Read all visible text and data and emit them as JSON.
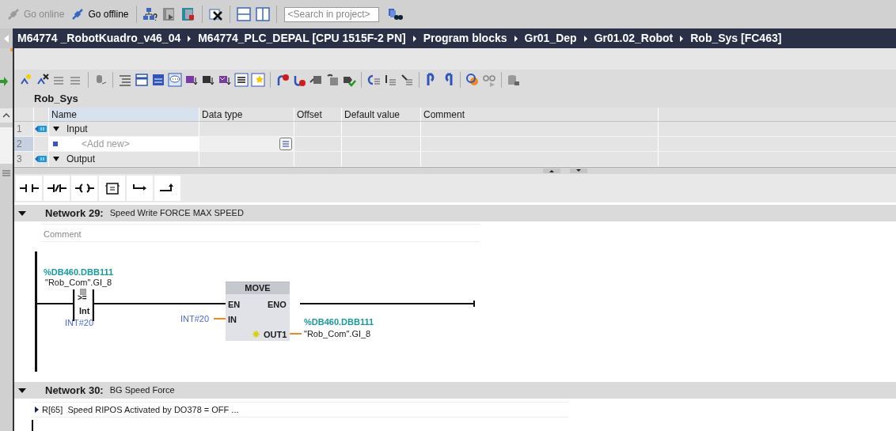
{
  "toolbar": {
    "buttons": [
      {
        "label": "Go online",
        "disabled": true
      },
      {
        "label": "Go offline",
        "disabled": false
      }
    ],
    "search": {
      "placeholder": "<Search in project>"
    }
  },
  "breadcrumb": [
    "M64774 _RobotKuadro_v46_04",
    "M64774_PLC_DEPAL [CPU 1515F-2 PN]",
    "Program blocks",
    "Gr01_Dep",
    "Gr01.02_Robot",
    "Rob_Sys [FC463]"
  ],
  "block_interface": {
    "title": "Rob_Sys",
    "columns": [
      "Name",
      "Data type",
      "Offset",
      "Default value",
      "Comment"
    ],
    "rows": [
      {
        "number": "1",
        "kind": "section",
        "name": "Input",
        "expanded": true,
        "selected": false
      },
      {
        "number": "2",
        "kind": "add",
        "name": "<Add new>",
        "selected": true
      },
      {
        "number": "3",
        "kind": "section",
        "name": "Output",
        "expanded": true,
        "selected": false
      }
    ]
  },
  "networks": [
    {
      "label": "Network 29:",
      "title": "Speed Write FORCE MAX SPEED",
      "expanded": true,
      "comment": {
        "placeholder": "Comment"
      },
      "ladder": {
        "contact": {
          "address": "%DB460.DBB111",
          "tag": "\"Rob_Com\".GI_8",
          "operator": ">=",
          "type": "Int",
          "operand": "INT#20"
        },
        "box": {
          "title": "MOVE",
          "en": "EN",
          "eno": "ENO",
          "in": "IN",
          "out": "OUT1",
          "in_value": "INT#20",
          "out_address": "%DB460.DBB111",
          "out_tag": "\"Rob_Com\".GI_8"
        }
      }
    },
    {
      "label": "Network 30:",
      "title": "BG Speed Force",
      "expanded": true,
      "comment": {
        "text": "R[65]  Speed RIPOS Activated by DO378 = OFF ...",
        "expanded": false
      }
    }
  ]
}
